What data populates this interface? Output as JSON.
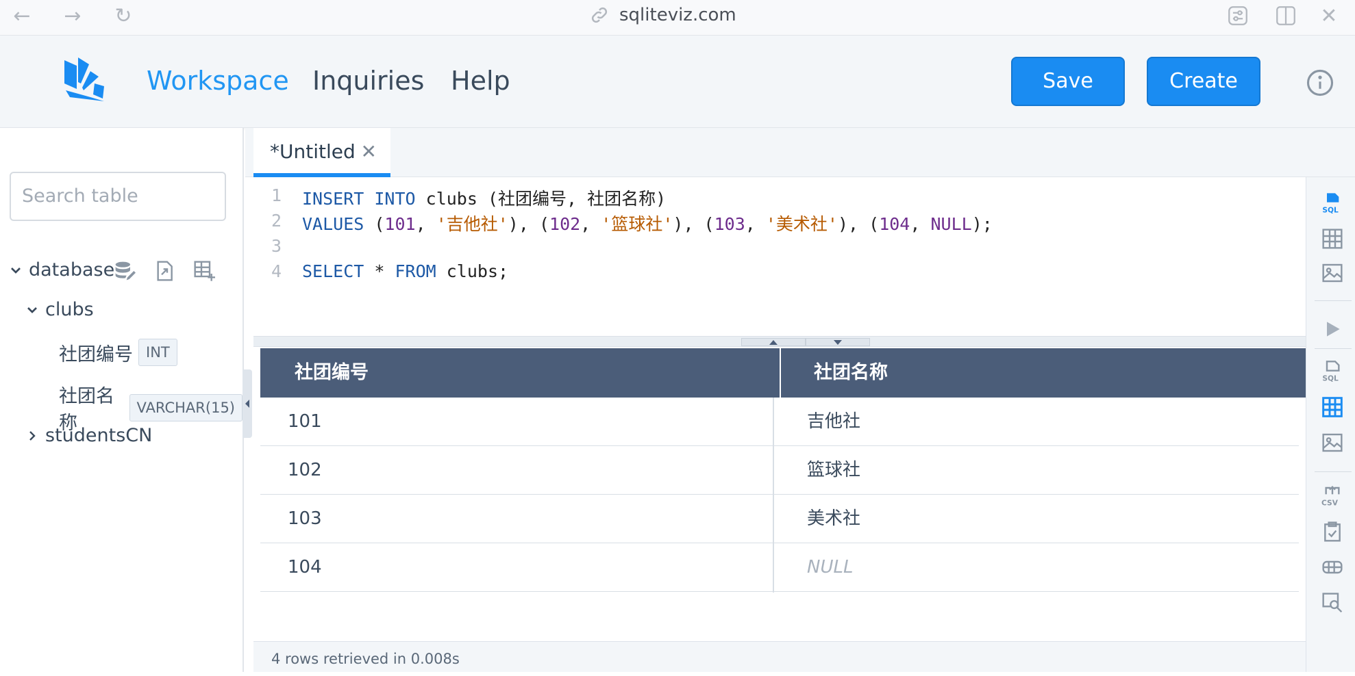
{
  "browser": {
    "url": "sqliteviz.com"
  },
  "nav": {
    "workspace": "Workspace",
    "inquiries": "Inquiries",
    "help": "Help"
  },
  "actions": {
    "save": "Save",
    "create": "Create"
  },
  "sidebar": {
    "search_placeholder": "Search table",
    "database_label": "database",
    "tables": [
      {
        "name": "clubs",
        "columns": [
          {
            "name": "社团编号",
            "type": "INT"
          },
          {
            "name": "社团名称",
            "type": "VARCHAR(15)"
          }
        ]
      },
      {
        "name": "studentsCN"
      }
    ]
  },
  "tab": {
    "title": "*Untitled",
    "close": "✕"
  },
  "editor": {
    "line_numbers": [
      "1",
      "2",
      "3",
      "4"
    ],
    "lines": [
      "INSERT INTO clubs (社团编号, 社团名称)",
      "VALUES (101, '吉他社'), (102, '篮球社'), (103, '美术社'), (104, NULL);",
      "",
      "SELECT * FROM clubs;"
    ]
  },
  "results": {
    "columns": [
      "社团编号",
      "社团名称"
    ],
    "rows": [
      [
        "101",
        "吉他社"
      ],
      [
        "102",
        "篮球社"
      ],
      [
        "103",
        "美术社"
      ],
      [
        "104",
        "NULL"
      ]
    ],
    "status": "4 rows retrieved in 0.008s"
  },
  "colors": {
    "accent": "#1a8cf2",
    "header_bg": "#4b5d79"
  }
}
